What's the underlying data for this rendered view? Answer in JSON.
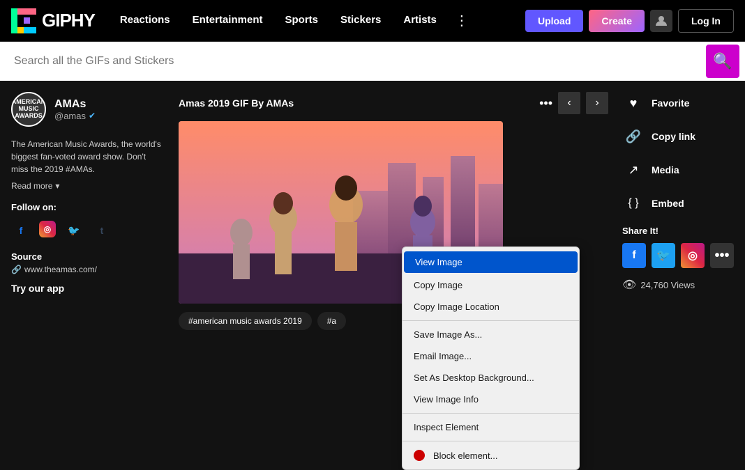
{
  "header": {
    "logo_text": "GIPHY",
    "nav_items": [
      {
        "label": "Reactions",
        "id": "reactions"
      },
      {
        "label": "Entertainment",
        "id": "entertainment"
      },
      {
        "label": "Sports",
        "id": "sports"
      },
      {
        "label": "Stickers",
        "id": "stickers"
      },
      {
        "label": "Artists",
        "id": "artists"
      }
    ],
    "btn_upload": "Upload",
    "btn_create": "Create",
    "btn_login": "Log In"
  },
  "search": {
    "placeholder": "Search all the GIFs and Stickers"
  },
  "channel": {
    "name": "AMAs",
    "handle": "@amas",
    "verified": true,
    "description": "The American Music Awards, the world's biggest fan-voted award show. Don't miss the 2019 #AMAs.",
    "read_more": "Read more",
    "follow_label": "Follow on:",
    "source_label": "Source",
    "source_url": "www.theamas.com/",
    "try_app": "Try our app"
  },
  "gif": {
    "title": "Amas 2019 GIF By AMAs",
    "tag1": "#american music awards 2019",
    "tag2": "#a"
  },
  "actions": {
    "favorite": "Favorite",
    "copy_link": "Copy link",
    "media": "Media",
    "embed": "Embed",
    "share_label": "Share It!",
    "views_count": "24,760 Views"
  },
  "context_menu": {
    "items": [
      {
        "label": "View Image",
        "highlighted": true
      },
      {
        "label": "Copy Image",
        "highlighted": false
      },
      {
        "label": "Copy Image Location",
        "highlighted": false
      },
      {
        "label": "Save Image As...",
        "highlighted": false
      },
      {
        "label": "Email Image...",
        "highlighted": false
      },
      {
        "label": "Set As Desktop Background...",
        "highlighted": false
      },
      {
        "label": "View Image Info",
        "highlighted": false
      },
      {
        "label": "Inspect Element",
        "highlighted": false
      },
      {
        "label": "Block element...",
        "highlighted": false,
        "has_icon": true
      }
    ]
  }
}
